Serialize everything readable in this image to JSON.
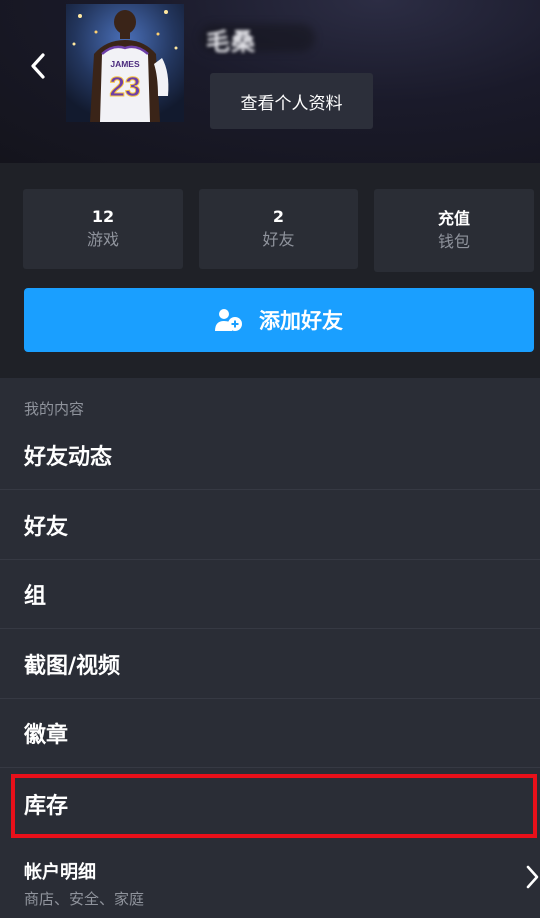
{
  "header": {
    "username": "毛桑",
    "view_profile_label": "查看个人资料",
    "avatar": {
      "jersey_name": "JAMES",
      "jersey_number": "23"
    }
  },
  "stats": [
    {
      "value": "12",
      "label": "游戏"
    },
    {
      "value": "2",
      "label": "好友"
    },
    {
      "value": "充值",
      "label": "钱包"
    }
  ],
  "add_friend_label": "添加好友",
  "my_content": {
    "section_label": "我的内容",
    "items": [
      {
        "label": "好友动态"
      },
      {
        "label": "好友"
      },
      {
        "label": "组"
      },
      {
        "label": "截图/视频"
      },
      {
        "label": "徽章"
      },
      {
        "label": "库存"
      }
    ]
  },
  "account": {
    "title": "帐户明细",
    "subtitle": "商店、安全、家庭"
  },
  "colors": {
    "accent": "#1a9fff",
    "highlight_box": "#e8101a",
    "background": "#2a2d36"
  }
}
